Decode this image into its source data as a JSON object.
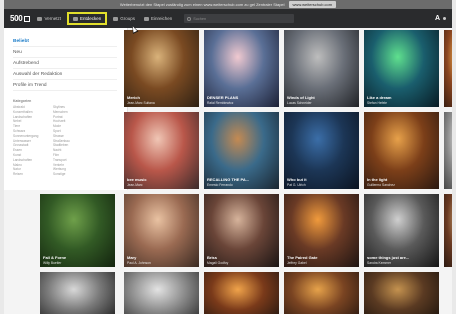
{
  "notice": {
    "text": "Weiterbenutzt den Stapel zuständig zum einen www.weiterschub.com zu gel Zentraler Stapel",
    "button": "www.weiterschub.com"
  },
  "topbar": {
    "logo": "500",
    "nav": [
      {
        "label": "Vernetzt"
      },
      {
        "label": "Entdecken"
      },
      {
        "label": "Groups"
      },
      {
        "label": "Einreichen"
      }
    ],
    "search_placeholder": "Suchen",
    "user_initial": "A"
  },
  "sidebar": {
    "links": [
      "Beliebt",
      "Neu",
      "Aufstrebend",
      "Auswahl der Redaktion",
      "Profile im Trend"
    ],
    "categories_heading": "Kategorien",
    "categories_left": [
      "Abstrakt",
      "Konzerthallen",
      "Landschaften",
      "Nebel",
      "Tiere",
      "Schwarz",
      "Sonnenuntergang",
      "Unterwasser",
      "Grossstadt",
      "Essen",
      "Kunst",
      "Landschaften",
      "Makro",
      "Natur",
      "Reisen"
    ],
    "categories_right": [
      "Skylines",
      "Menschen",
      "Portrat",
      "Hochzeit",
      "Mode",
      "Sport",
      "Strasse",
      "Straßenbau",
      "Stadtleben",
      "Nacht",
      "Film",
      "Transport",
      "Verkehr",
      "Werbung",
      "Sonstige"
    ]
  },
  "photos": [
    {
      "title": "Merich",
      "author": "Jean-Marc Sultana",
      "colors": [
        "#d9b27a",
        "#7a4a22",
        "#2d2013"
      ]
    },
    {
      "title": "DENSER PLANS",
      "author": "Rafal Rembiewicz",
      "colors": [
        "#f0c9d0",
        "#5a6f96",
        "#1c2035"
      ]
    },
    {
      "title": "Winds of Light",
      "author": "Lucas Schneider",
      "colors": [
        "#bdbdbd",
        "#6a6f78",
        "#202226"
      ]
    },
    {
      "title": "Like a dream",
      "author": "Stefan Hefele",
      "colors": [
        "#5fe08e",
        "#1a5e6d",
        "#081a23"
      ]
    },
    {
      "title": "",
      "author": "",
      "colors": [
        "#f7b24f",
        "#8a4520",
        "#2a1710"
      ]
    },
    {
      "title": "bee music",
      "author": "Jean-Marc",
      "colors": [
        "#f0c6b5",
        "#b9574a",
        "#3a2b2b"
      ]
    },
    {
      "title": "RECALLING THE PA...",
      "author": "Ernesto Ferrando",
      "colors": [
        "#c48a52",
        "#3a6a8a",
        "#1a2530"
      ]
    },
    {
      "title": "Who but it",
      "author": "Pat G. Ulrich",
      "colors": [
        "#3b6ea8",
        "#1c3656",
        "#0b1320"
      ]
    },
    {
      "title": "In the light",
      "author": "Guillermo Sanchez",
      "colors": [
        "#e7a14a",
        "#7c3f19",
        "#2a1810"
      ]
    },
    {
      "title": "",
      "author": "",
      "colors": [
        "#d8d8d8",
        "#8a8a8a",
        "#3a3a3a"
      ]
    },
    {
      "title": "Fall & Forne",
      "author": "Willy Buetler",
      "colors": [
        "#6fa04a",
        "#325a25",
        "#13230e"
      ]
    },
    {
      "title": "Mary",
      "author": "Paul A. Johnson",
      "colors": [
        "#e9c2a2",
        "#9a6a52",
        "#3a2a22"
      ]
    },
    {
      "title": "Briss",
      "author": "Magali Godfoy",
      "colors": [
        "#d6b39b",
        "#6a4538",
        "#1a1413"
      ]
    },
    {
      "title": "The Paired Gate",
      "author": "Jeffrey Gabel",
      "colors": [
        "#f09a3c",
        "#6a3a25",
        "#1e1412"
      ]
    },
    {
      "title": "some things just are...",
      "author": "Sandra Kemmer",
      "colors": [
        "#cfcfcf",
        "#5a5a5a",
        "#151515"
      ]
    },
    {
      "title": "",
      "author": "",
      "colors": [
        "#c49a6a",
        "#6a3a22",
        "#20140e"
      ]
    },
    {
      "title": "",
      "author": "",
      "colors": [
        "#d8d8d8",
        "#7a7a7a",
        "#1a1a1a"
      ]
    },
    {
      "title": "",
      "author": "",
      "colors": [
        "#e3e3e3",
        "#8f8f8f",
        "#2a2a2a"
      ]
    },
    {
      "title": "",
      "author": "",
      "colors": [
        "#f0a34a",
        "#7a3a1a",
        "#1e1410"
      ]
    },
    {
      "title": "",
      "author": "",
      "colors": [
        "#e6a24a",
        "#7a4422",
        "#24150f"
      ]
    },
    {
      "title": "",
      "author": "",
      "colors": [
        "#c4924f",
        "#5a3a22",
        "#1a120c"
      ]
    }
  ]
}
